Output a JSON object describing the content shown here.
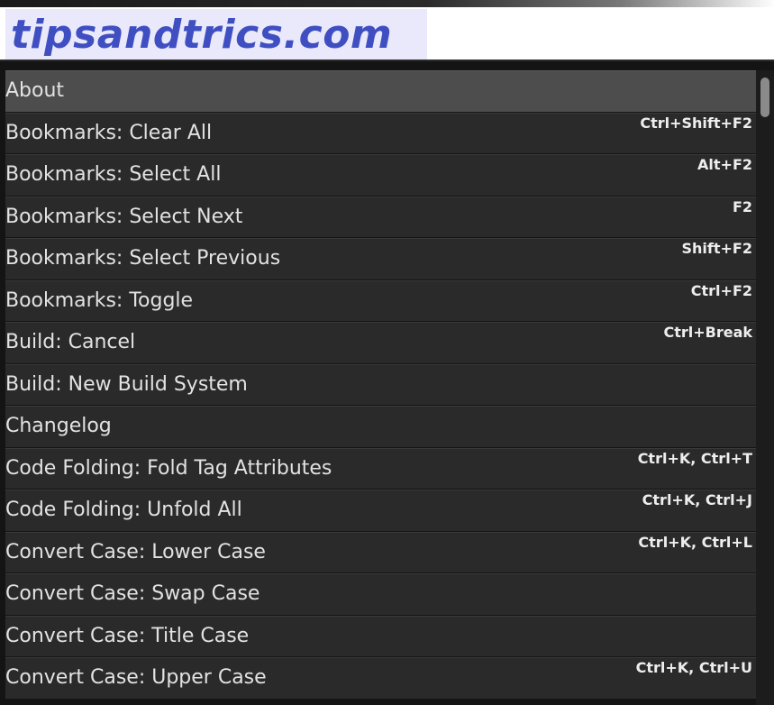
{
  "watermark": {
    "text": "tipsandtrics.com"
  },
  "commands": [
    {
      "label": "About",
      "shortcut": ""
    },
    {
      "label": "Bookmarks: Clear All",
      "shortcut": "Ctrl+Shift+F2"
    },
    {
      "label": "Bookmarks: Select All",
      "shortcut": "Alt+F2"
    },
    {
      "label": "Bookmarks: Select Next",
      "shortcut": "F2"
    },
    {
      "label": "Bookmarks: Select Previous",
      "shortcut": "Shift+F2"
    },
    {
      "label": "Bookmarks: Toggle",
      "shortcut": "Ctrl+F2"
    },
    {
      "label": "Build: Cancel",
      "shortcut": "Ctrl+Break"
    },
    {
      "label": "Build: New Build System",
      "shortcut": ""
    },
    {
      "label": "Changelog",
      "shortcut": ""
    },
    {
      "label": "Code Folding: Fold Tag Attributes",
      "shortcut": "Ctrl+K, Ctrl+T"
    },
    {
      "label": "Code Folding: Unfold All",
      "shortcut": "Ctrl+K, Ctrl+J"
    },
    {
      "label": "Convert Case: Lower Case",
      "shortcut": "Ctrl+K, Ctrl+L"
    },
    {
      "label": "Convert Case: Swap Case",
      "shortcut": ""
    },
    {
      "label": "Convert Case: Title Case",
      "shortcut": ""
    },
    {
      "label": "Convert Case: Upper Case",
      "shortcut": "Ctrl+K, Ctrl+U"
    }
  ],
  "selected_index": 0,
  "colors": {
    "row_background": "#2a2a2a",
    "row_selected": "#4d4d4d",
    "text": "#e2e2e2",
    "watermark_text": "#3f4fc2",
    "watermark_bg": "#e9e9fb"
  }
}
